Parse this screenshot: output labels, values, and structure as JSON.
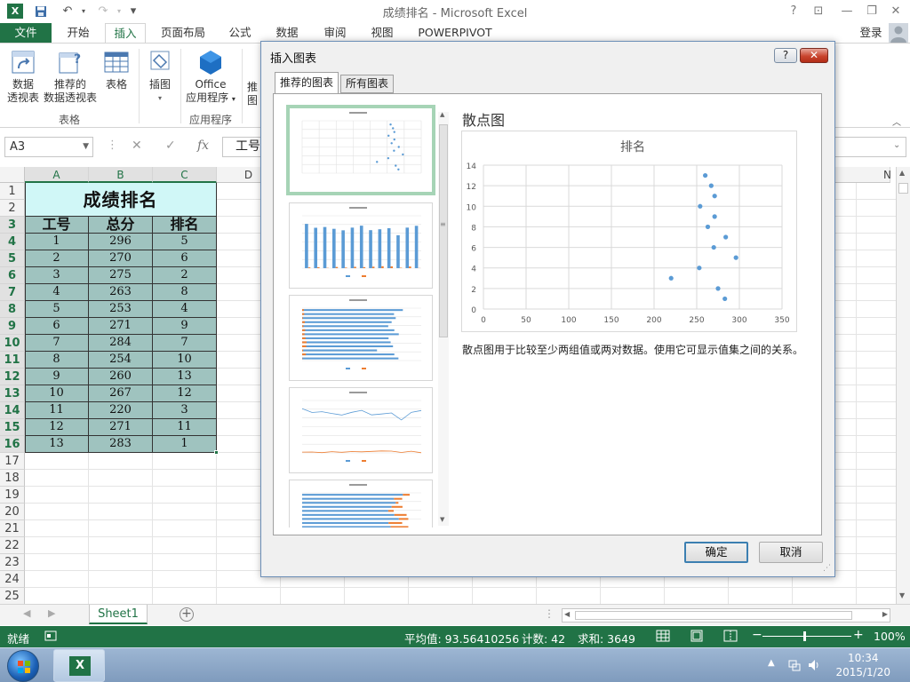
{
  "window": {
    "title": "成绩排名 - Microsoft Excel",
    "controls": {
      "help": "?",
      "ribbon_options": "⊡",
      "minimize": "—",
      "restore": "❐",
      "close": "✕"
    }
  },
  "quick_access": {
    "save_icon": "save-icon",
    "undo": "↶",
    "redo": "↷",
    "customize": "▾"
  },
  "ribbon_tabs": [
    "文件",
    "开始",
    "插入",
    "页面布局",
    "公式",
    "数据",
    "审阅",
    "视图",
    "POWERPIVOT"
  ],
  "active_tab": "插入",
  "account": {
    "login": "登录"
  },
  "ribbon": {
    "pivot_table": "数据\n透视表",
    "pivot_label_1": "数据",
    "pivot_label_2": "透视表",
    "recommended_pivot_1": "推荐的",
    "recommended_pivot_2": "数据透视表",
    "table": "表格",
    "group_tables": "表格",
    "illustrations": "插图",
    "office_apps_1": "Office",
    "office_apps_2": "应用程序",
    "group_apps": "应用程序",
    "partial_next": "推",
    "partial_next_2": "图"
  },
  "formula_bar": {
    "name_box": "A3",
    "cancel": "✕",
    "enter": "✓",
    "fx": "fx",
    "content": "工号"
  },
  "sheet": {
    "columns": [
      "A",
      "B",
      "C",
      "D"
    ],
    "far_column": "N",
    "rows": [
      "1",
      "2",
      "3",
      "4",
      "5",
      "6",
      "7",
      "8",
      "9",
      "10",
      "11",
      "12",
      "13",
      "14",
      "15",
      "16",
      "17",
      "18",
      "19",
      "20",
      "21",
      "22",
      "23",
      "24",
      "25"
    ],
    "table_title": "成绩排名",
    "headers": [
      "工号",
      "总分",
      "排名"
    ],
    "data": [
      [
        "1",
        "296",
        "5"
      ],
      [
        "2",
        "270",
        "6"
      ],
      [
        "3",
        "275",
        "2"
      ],
      [
        "4",
        "263",
        "8"
      ],
      [
        "5",
        "253",
        "4"
      ],
      [
        "6",
        "271",
        "9"
      ],
      [
        "7",
        "284",
        "7"
      ],
      [
        "8",
        "254",
        "10"
      ],
      [
        "9",
        "260",
        "13"
      ],
      [
        "10",
        "267",
        "12"
      ],
      [
        "11",
        "220",
        "3"
      ],
      [
        "12",
        "271",
        "11"
      ],
      [
        "13",
        "283",
        "1"
      ]
    ]
  },
  "sheet_tabs": {
    "active": "Sheet1",
    "add": "+"
  },
  "status_bar": {
    "ready": "就绪",
    "average": "平均值: 93.56410256",
    "count": "计数: 42",
    "sum": "求和: 3649",
    "zoom": "100%",
    "zoom_minus": "−",
    "zoom_plus": "+"
  },
  "dialog": {
    "title": "插入图表",
    "help": "?",
    "close": "✕",
    "tabs": [
      "推荐的图表",
      "所有图表"
    ],
    "preview_type": "散点图",
    "description": "散点图用于比较至少两组值或两对数据。使用它可显示值集之间的关系。",
    "ok": "确定",
    "cancel": "取消"
  },
  "taskbar": {
    "time": "10:34",
    "date": "2015/1/20"
  },
  "colors": {
    "excel_green": "#217346",
    "title_fill": "#d0f7f7",
    "table_fill": "#9fc3bf",
    "series": "#5b9bd5",
    "series2": "#ed7d31"
  },
  "chart_data": {
    "type": "scatter",
    "title": "排名",
    "x": [
      296,
      270,
      275,
      263,
      253,
      271,
      284,
      254,
      260,
      267,
      220,
      271,
      283
    ],
    "y": [
      5,
      6,
      2,
      8,
      4,
      9,
      7,
      10,
      13,
      12,
      3,
      11,
      1
    ],
    "xlim": [
      0,
      350
    ],
    "ylim": [
      0,
      14
    ],
    "xticks": [
      0,
      50,
      100,
      150,
      200,
      250,
      300,
      350
    ],
    "yticks": [
      0,
      2,
      4,
      6,
      8,
      10,
      12,
      14
    ],
    "grid": true
  }
}
